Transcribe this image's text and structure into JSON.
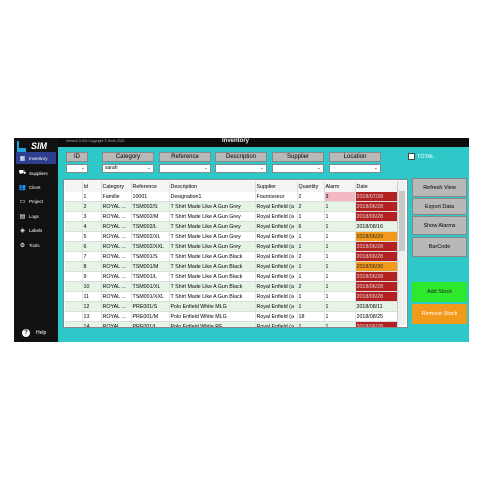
{
  "window": {
    "version": "Version 3.024  Copyright © Sinfo 2022",
    "title": "Inventory"
  },
  "logo": {
    "text": "SIM"
  },
  "sidebar": {
    "items": [
      {
        "label": "Inventory",
        "icon": "boxes-icon"
      },
      {
        "label": "Suppliers",
        "icon": "truck-icon"
      },
      {
        "label": "Client",
        "icon": "users-icon"
      },
      {
        "label": "Project",
        "icon": "folder-icon"
      },
      {
        "label": "Logs",
        "icon": "document-icon"
      },
      {
        "label": "Labels",
        "icon": "tag-icon"
      },
      {
        "label": "Tools",
        "icon": "gear-icon"
      }
    ],
    "help": "Help"
  },
  "filters": {
    "id": {
      "label": "ID",
      "value": ""
    },
    "category": {
      "label": "Category",
      "value": "sarah"
    },
    "reference": {
      "label": "Reference",
      "value": ""
    },
    "description": {
      "label": "Description",
      "value": ""
    },
    "supplier": {
      "label": "Supplier",
      "value": ""
    },
    "location": {
      "label": "Location",
      "value": ""
    },
    "total_label": "TOTAL"
  },
  "table": {
    "columns": [
      "",
      "Id",
      "Category",
      "Reference",
      "Description",
      "Supplier",
      "Quantity",
      "Alarm",
      "Date"
    ],
    "rows": [
      [
        "",
        "1",
        "Famille",
        "10001",
        "Designation1",
        "Fournisseur",
        "2",
        "3",
        "2018/07/28"
      ],
      [
        "",
        "2",
        "ROYAL ...",
        "TSM002/S",
        "T Shirt Made Like A Gun Grey",
        "Royal Enfield (a",
        "2",
        "1",
        "2018/06/28"
      ],
      [
        "",
        "3",
        "ROYAL ...",
        "TSM002/M",
        "T Shirt Made Like A Gun Grey",
        "Royal Enfield (a",
        "1",
        "1",
        "2018/06/28"
      ],
      [
        "",
        "4",
        "ROYAL ...",
        "TSM002/L",
        "T Shirt Made Like A Gun Grey",
        "Royal Enfield (a",
        "6",
        "1",
        "2018/08/16"
      ],
      [
        "",
        "5",
        "ROYAL ...",
        "TSM002/XL",
        "T Shirt Made Like A Gun Grey",
        "Royal Enfield (a",
        "1",
        "1",
        "2018/06/29"
      ],
      [
        "",
        "6",
        "ROYAL ...",
        "TSM002/XXL",
        "T Shirt Made Like A Gun Grey",
        "Royal Enfield (a",
        "1",
        "1",
        "2018/06/28"
      ],
      [
        "",
        "7",
        "ROYAL ...",
        "TSM001/S",
        "T Shirt Made Like A Gun Black",
        "Royal Enfield (a",
        "2",
        "1",
        "2018/06/28"
      ],
      [
        "",
        "8",
        "ROYAL ...",
        "TSM001/M",
        "T Shirt Made Like A Gun Black",
        "Royal Enfield (a",
        "1",
        "1",
        "2018/06/30"
      ],
      [
        "",
        "9",
        "ROYAL ...",
        "TSM001/L",
        "T Shirt Made Like A Gun Black",
        "Royal Enfield (a",
        "1",
        "1",
        "2018/06/28"
      ],
      [
        "",
        "10",
        "ROYAL ...",
        "TSM001/XL",
        "T Shirt Made Like A Gun Black",
        "Royal Enfield (a",
        "2",
        "1",
        "2018/06/28"
      ],
      [
        "",
        "11",
        "ROYAL ...",
        "TSM001/XXL",
        "T Shirt Made Like A Gun Black",
        "Royal Enfield (a",
        "1",
        "1",
        "2018/06/28"
      ],
      [
        "",
        "12",
        "ROYAL ...",
        "PRE001/S",
        "Polo Enfield White MLG",
        "Royal Enfield (a",
        "1",
        "1",
        "2018/08/11"
      ],
      [
        "",
        "13",
        "ROYAL ...",
        "PRE001/M",
        "Polo Enfield White MLG",
        "Royal Enfield (a",
        "18",
        "1",
        "2018/08/25"
      ],
      [
        "",
        "14",
        "ROYAL ...",
        "PRE001/L",
        "Polo Enfield White RF",
        "Royal Enfield (a",
        "1",
        "1",
        "2018/06/28"
      ]
    ],
    "date_status": [
      "red",
      "red",
      "red",
      "none",
      "orange",
      "red",
      "red",
      "orange",
      "red",
      "red",
      "red",
      "none",
      "none",
      "red"
    ]
  },
  "actions": {
    "refresh": "Refresh View",
    "export": "Export Data",
    "alarms": "Show Alarms",
    "barcode": "BarCode",
    "add_stock": "Add Stock",
    "remove_stock": "Remove Stock"
  },
  "colors": {
    "background": "#2ec8c8",
    "sidebar": "#111111",
    "active_nav": "#2f3f8f",
    "alarm_pink": "#f4b8c3",
    "date_red": "#b22222",
    "date_orange": "#f29a1c",
    "add_green": "#2ee82e",
    "remove_orange": "#f29a1c"
  }
}
